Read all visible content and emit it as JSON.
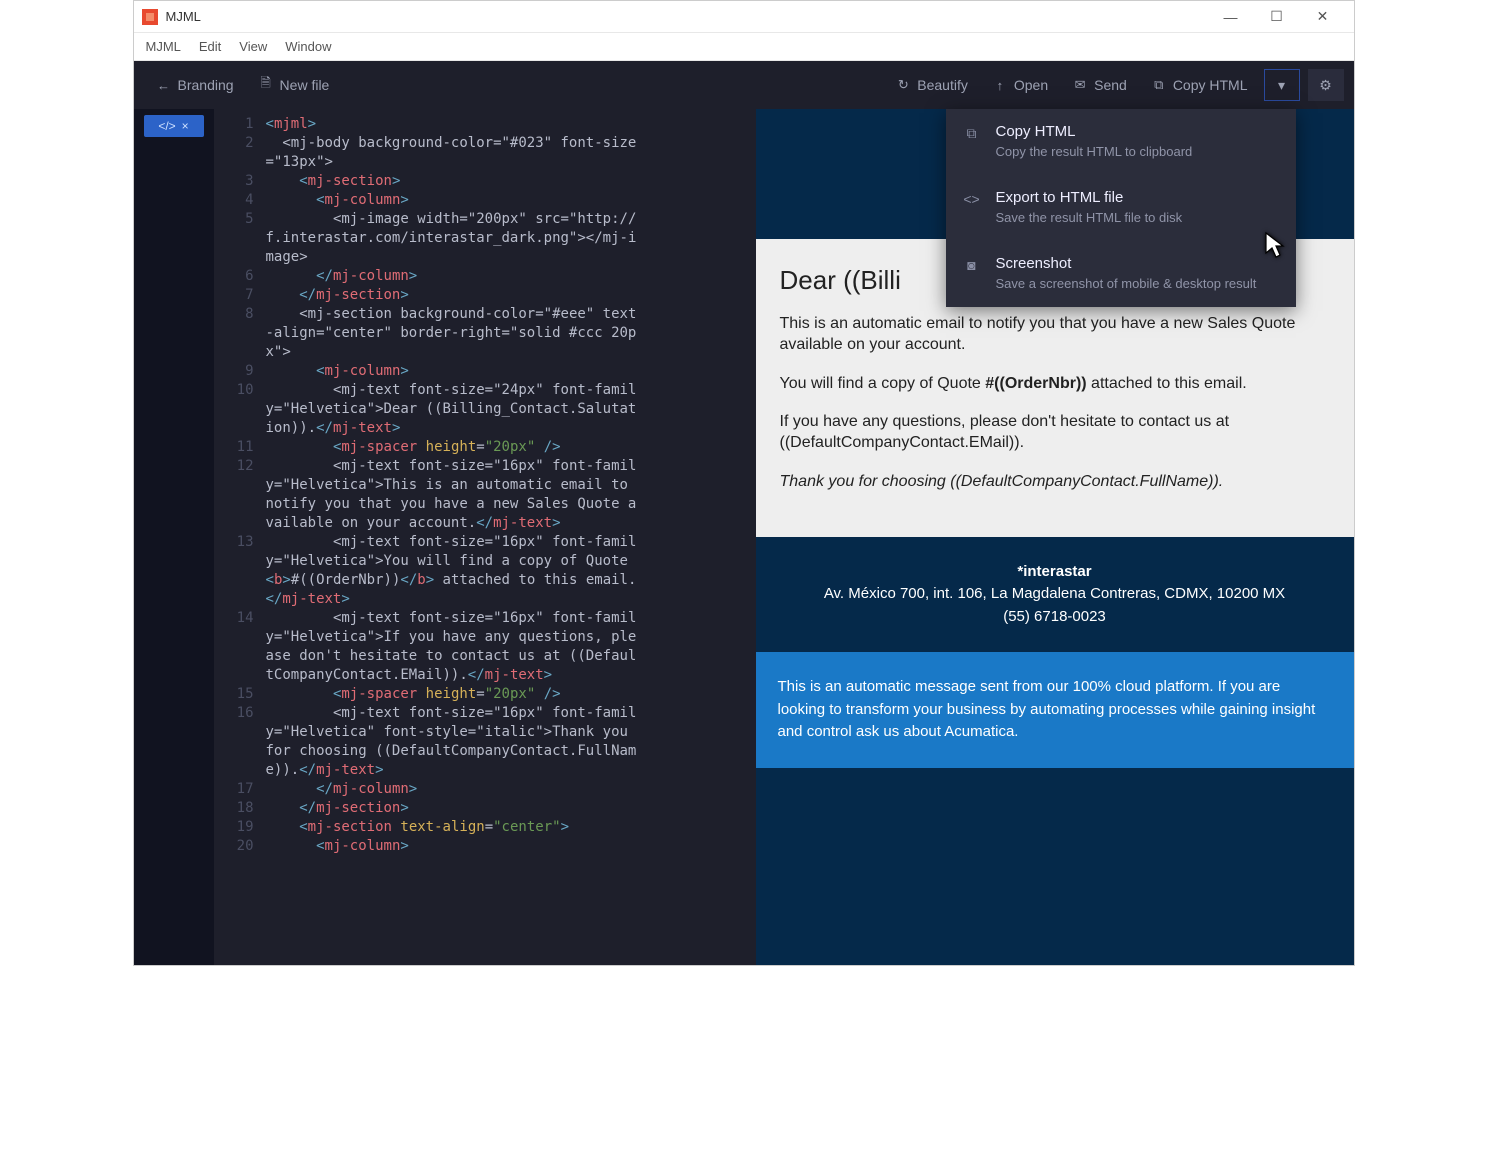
{
  "window": {
    "title": "MJML"
  },
  "menubar": [
    "MJML",
    "Edit",
    "View",
    "Window"
  ],
  "toolbar": {
    "back": "Branding",
    "newfile": "New file",
    "beautify": "Beautify",
    "open": "Open",
    "send": "Send",
    "copyhtml": "Copy HTML"
  },
  "dropdown": [
    {
      "icon": "copy-icon",
      "title": "Copy HTML",
      "sub": "Copy the result HTML to clipboard"
    },
    {
      "icon": "code-icon",
      "title": "Export to HTML file",
      "sub": "Save the result HTML file to disk"
    },
    {
      "icon": "camera-icon",
      "title": "Screenshot",
      "sub": "Save a screenshot of mobile & desktop result"
    }
  ],
  "editor": {
    "lines": [
      1,
      2,
      3,
      4,
      5,
      6,
      7,
      8,
      9,
      10,
      11,
      12,
      13,
      14,
      15,
      16,
      17,
      18,
      19,
      20
    ],
    "code_raw": "<mjml>\n  <mj-body background-color=\"#023\" font-size=\"13px\">\n    <mj-section>\n      <mj-column>\n        <mj-image width=\"200px\" src=\"http://f.interastar.com/interastar_dark.png\"></mj-image>\n      </mj-column>\n    </mj-section>\n    <mj-section background-color=\"#eee\" text-align=\"center\" border-right=\"solid #ccc 20px\">\n      <mj-column>\n        <mj-text font-size=\"24px\" font-family=\"Helvetica\">Dear ((Billing_Contact.Salutation)).</mj-text>\n        <mj-spacer height=\"20px\" />\n        <mj-text font-size=\"16px\" font-family=\"Helvetica\">This is an automatic email to notify you that you have a new Sales Quote available on your account.</mj-text>\n        <mj-text font-size=\"16px\" font-family=\"Helvetica\">You will find a copy of Quote <b>#((OrderNbr))</b> attached to this email.</mj-text>\n        <mj-text font-size=\"16px\" font-family=\"Helvetica\">If you have any questions, please don't hesitate to contact us at ((DefaultCompanyContact.EMail)).</mj-text>\n        <mj-spacer height=\"20px\" />\n        <mj-text font-size=\"16px\" font-family=\"Helvetica\" font-style=\"italic\">Thank you for choosing ((DefaultCompanyContact.FullName)).</mj-text>\n      </mj-column>\n    </mj-section>\n    <mj-section text-align=\"center\">\n      <mj-column>"
  },
  "preview": {
    "dear": "Dear ((Billing_Contact.Salutation)).",
    "dear_visible": "Dear ((Billi",
    "p1": "This is an automatic email to notify you that you have a new Sales Quote available on your account.",
    "p2a": "You will find a copy of Quote ",
    "p2b": "#((OrderNbr))",
    "p2c": " attached to this email.",
    "p3": "If you have any questions, please don't hesitate to contact us at ((DefaultCompanyContact.EMail)).",
    "p4": "Thank you for choosing ((DefaultCompanyContact.FullName)).",
    "footer_name": "*interastar",
    "footer_addr": "Av. México 700, int. 106, La Magdalena Contreras, CDMX, 10200 MX",
    "footer_phone": "(55) 6718-0023",
    "cta": "This is an automatic message sent from our 100% cloud platform. If you are looking to transform your business by automating processes while gaining insight and control ask us about Acumatica."
  }
}
